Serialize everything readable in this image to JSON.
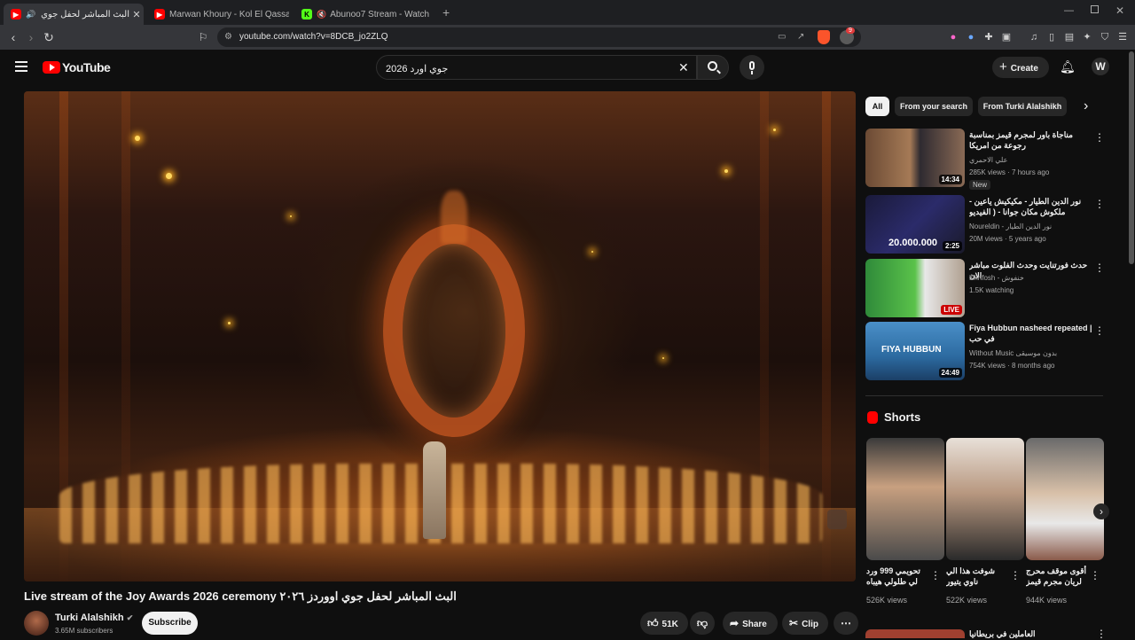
{
  "browser": {
    "tabs": [
      {
        "title": "البث المباشر لحفل جوي اووردز",
        "active": true
      },
      {
        "title": "Marwan Khoury - Kol El Qassayed | C",
        "active": false
      },
      {
        "title": "Abunoo7 Stream - Watch Live on",
        "active": false
      }
    ],
    "url": "youtube.com/watch?v=8DCB_jo2ZLQ",
    "brave_badge": "9"
  },
  "header": {
    "logo": "YouTube",
    "search_value": "جوي اورد 2026",
    "create_label": "Create"
  },
  "video": {
    "title": "Live stream of the Joy Awards 2026 ceremony البث المباشر لحفل جوي اووردز ٢٠٢٦",
    "channel": "Turki Alalshikh",
    "subscribers": "3.65M subscribers",
    "subscribe_label": "Subscribe",
    "likes": "51K",
    "share_label": "Share",
    "clip_label": "Clip"
  },
  "sidebar": {
    "chips": [
      "All",
      "From your search",
      "From Turki Alalshikh"
    ],
    "recommendations": [
      {
        "title": "مناجاة باور لمجرم قيمز بمناسبة رجوعة من امريكا",
        "channel": "علي الاحمري",
        "meta": "285K views · 7 hours ago",
        "duration": "14:34",
        "badge": "New"
      },
      {
        "title": "نور الدين الطيار - مكيكيش ياعين - ملكوش مكان جوانا - ( الفيديو الرسمي )",
        "channel": "Noureldin - نور الدين الطيار",
        "meta": "20M views · 5 years ago",
        "duration": "2:25",
        "thumb_text": "20.000.000"
      },
      {
        "title": "حدث فورتنايت وحدث الفلوت مباشر الان",
        "channel": "Khnfosh - خنفوش",
        "meta": "1.5K watching",
        "live": "LIVE"
      },
      {
        "title": "Fiya Hubbun nasheed repeated | في حب",
        "channel": "Without Music بدون موسيقى",
        "meta": "754K views · 8 months ago",
        "duration": "24:49",
        "thumb_text": "FIYA HUBBUN"
      }
    ],
    "shorts_heading": "Shorts",
    "shorts": [
      {
        "title": "تحويمي 999 ورد لي طلولي هيباه",
        "views": "526K views"
      },
      {
        "title": "شوفت هذا الي ناوي يتيور",
        "views": "522K views"
      },
      {
        "title": "أقوى موقف محرج لريان مجرم قيمز",
        "views": "944K views"
      }
    ],
    "next_item_title": "العاملين في بريطانيا"
  },
  "colors": {
    "background": "#0f0f0f",
    "youtube_red": "#ff0000",
    "live_red": "#cc0000"
  }
}
